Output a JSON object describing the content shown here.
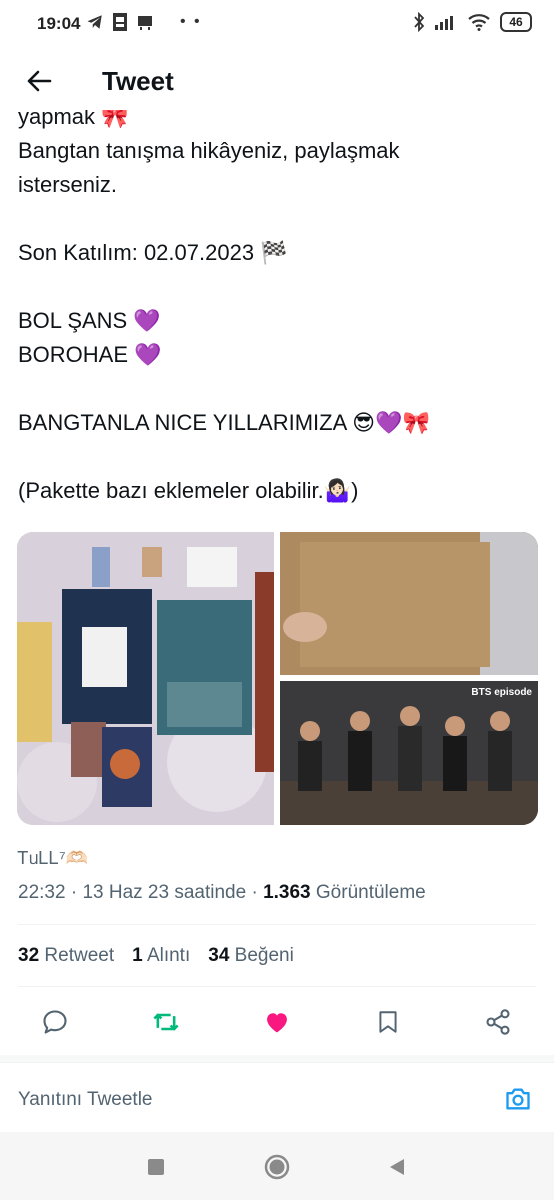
{
  "status_bar": {
    "time": "19:04",
    "battery": "46",
    "dots": "• •"
  },
  "header": {
    "title": "Tweet"
  },
  "tweet": {
    "lines": [
      "yapmak 🎀",
      "Bangtan tanışma hikâyeniz, paylaşmak",
      "isterseniz.",
      "",
      "Son Katılım:  02.07.2023 🏁",
      "",
      "BOL ŞANS 💜",
      "BOROHAE 💜",
      "",
      "BANGTANLA NICE YILLARIMIZA 😎💜🎀",
      "",
      "(Pakette bazı eklemeler olabilir.🤷🏻‍♀️)"
    ],
    "media": {
      "bts_label": "BTS episode"
    },
    "author": "ᎢᥙᏞᏞ⁷🫶🏻",
    "time": "22:32",
    "date": "13 Haz 23 saatinde",
    "views_count": "1.363",
    "views_label": "Görüntüleme",
    "retweet_count": "32",
    "retweet_label": "Retweet",
    "quote_count": "1",
    "quote_label": "Alıntı",
    "like_count": "34",
    "like_label": "Beğeni"
  },
  "reply": {
    "placeholder": "Yanıtını Tweetle"
  },
  "colors": {
    "text": "#0f1419",
    "secondary": "#536471",
    "retweet_green": "#00ba7c",
    "like_pink": "#f91880",
    "link_blue": "#1d9bf0"
  },
  "icons": {
    "back": "arrow-left-icon",
    "reply": "reply-icon",
    "retweet": "retweet-icon",
    "like": "heart-icon",
    "bookmark": "bookmark-icon",
    "share": "share-icon",
    "camera": "camera-icon"
  }
}
